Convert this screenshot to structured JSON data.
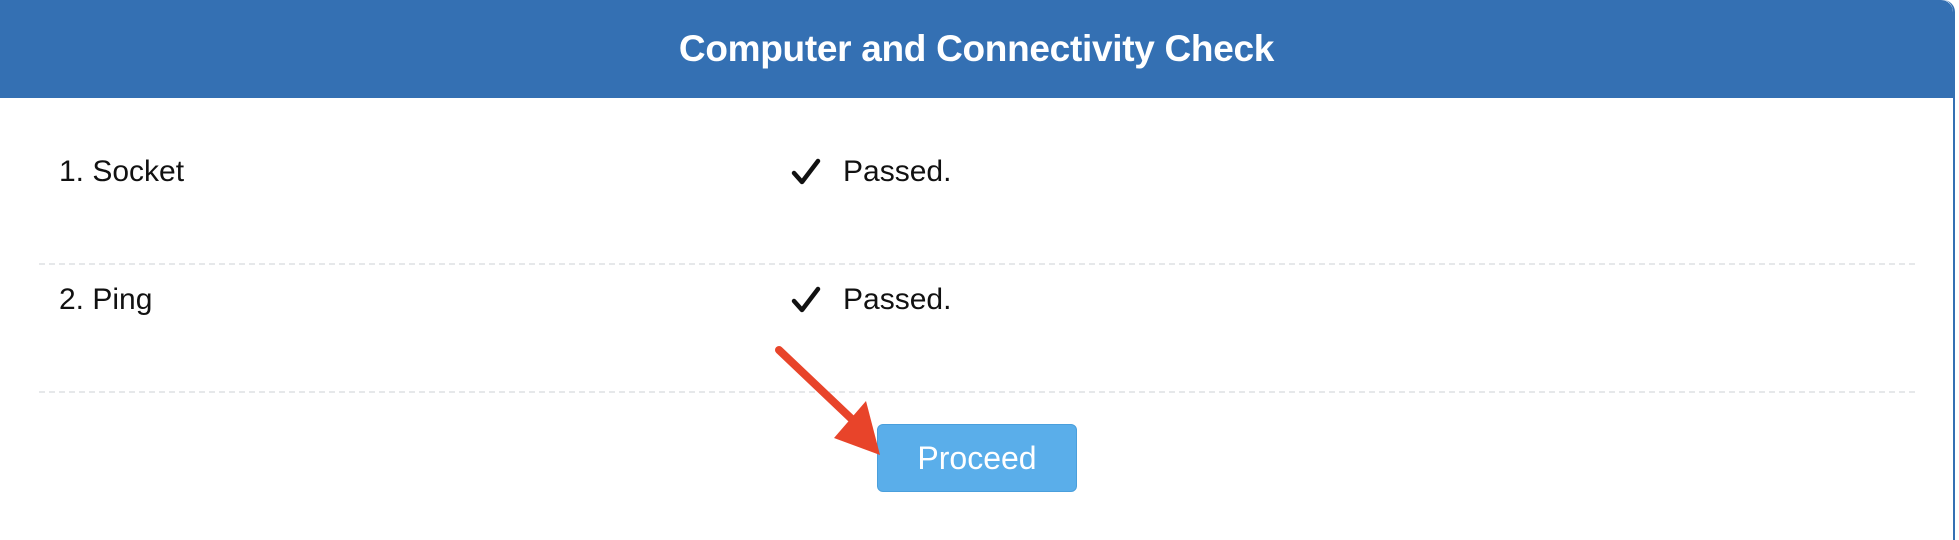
{
  "header": {
    "title": "Computer and Connectivity Check"
  },
  "checks": [
    {
      "label": "1. Socket",
      "status": "Passed.",
      "icon": "checkmark-icon"
    },
    {
      "label": "2. Ping",
      "status": "Passed.",
      "icon": "checkmark-icon"
    }
  ],
  "proceed_button": {
    "label": "Proceed"
  },
  "colors": {
    "header_bg": "#3470b3",
    "button_bg": "#5aaeea",
    "arrow": "#e8442a"
  }
}
